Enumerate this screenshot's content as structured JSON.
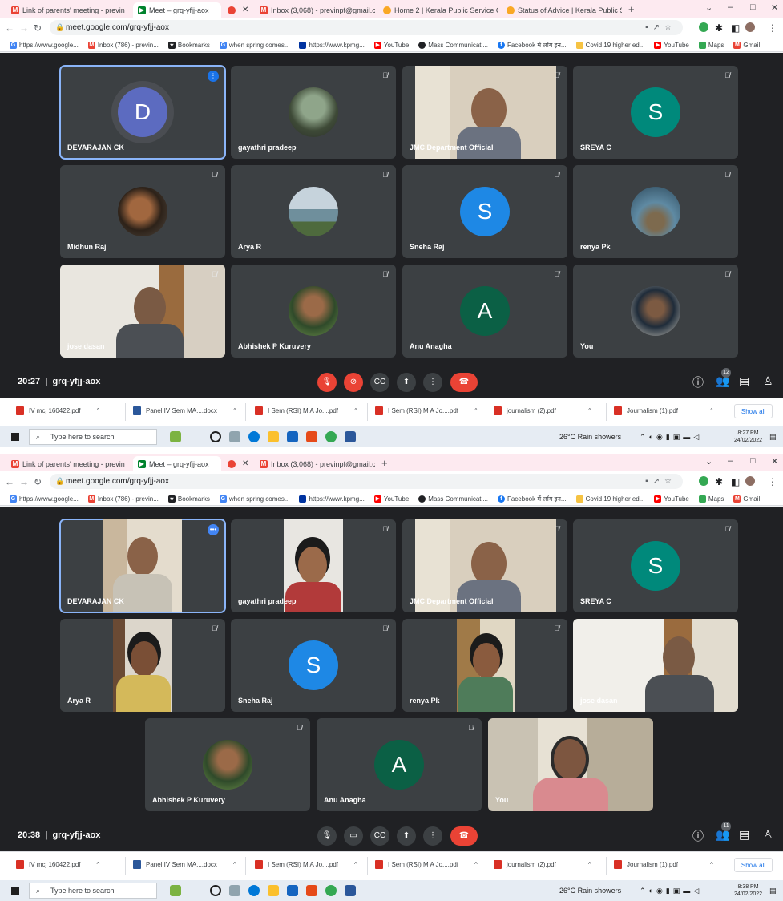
{
  "screenshots": [
    {
      "tabs": [
        {
          "title": "Link of parents' meeting - previn",
          "icon": "gmail-icon"
        },
        {
          "title": "Meet – grq-yfjj-aox",
          "icon": "meet-icon"
        },
        {
          "title": "",
          "icon": "record-icon"
        },
        {
          "title": "Inbox (3,068) - previnpf@gmail.c",
          "icon": "gmail-icon"
        },
        {
          "title": "Home 2 | Kerala Public Service C",
          "icon": "psc-icon"
        },
        {
          "title": "Status of Advice | Kerala Public S",
          "icon": "psc-icon"
        }
      ],
      "url": "meet.google.com/grq-yfjj-aox",
      "bookmarks": [
        "https://www.google...",
        "Inbox (786) - previn...",
        "Bookmarks",
        "when spring comes...",
        "https://www.kpmg...",
        "YouTube",
        "Mass Communicati...",
        "Facebook में लॉग इन...",
        "Covid 19 higher ed...",
        "YouTube",
        "Maps",
        "Gmail"
      ],
      "participants": [
        {
          "name": "DEVARAJAN CK",
          "kind": "avatar",
          "letter": "D",
          "color": "#5c6bc0",
          "speaking": true
        },
        {
          "name": "gayathri pradeep",
          "kind": "photo",
          "muted": true
        },
        {
          "name": "JMC Department Official",
          "kind": "video",
          "muted": true
        },
        {
          "name": "SREYA C",
          "kind": "avatar",
          "letter": "S",
          "color": "#00897b",
          "muted": true
        },
        {
          "name": "Midhun Raj",
          "kind": "photo",
          "muted": true
        },
        {
          "name": "Arya R",
          "kind": "photo",
          "muted": true
        },
        {
          "name": "Sneha Raj",
          "kind": "avatar",
          "letter": "S",
          "color": "#1e88e5",
          "muted": true
        },
        {
          "name": "renya Pk",
          "kind": "photo",
          "muted": true
        },
        {
          "name": "jose dasan",
          "kind": "video",
          "muted": true
        },
        {
          "name": "Abhishek P Kuruvery",
          "kind": "photo",
          "muted": true
        },
        {
          "name": "Anu Anagha",
          "kind": "avatar",
          "letter": "A",
          "color": "#0b6045",
          "muted": true
        },
        {
          "name": "You",
          "kind": "photo",
          "muted": true
        }
      ],
      "meeting_time": "20:27",
      "meeting_code": "grq-yfjj-aox",
      "participant_count": "12",
      "downloads": [
        "IV mcj 160422.pdf",
        "Panel IV Sem MA....docx",
        "I Sem (RSI) M A Jo....pdf",
        "I Sem (RSI) M A Jo....pdf",
        "journalism (2).pdf",
        "Journalism (1).pdf"
      ],
      "show_all": "Show all",
      "search_placeholder": "Type here to search",
      "weather": "26°C  Rain showers",
      "clock_time": "8:27 PM",
      "clock_date": "24/02/2022"
    },
    {
      "tabs": [
        {
          "title": "Link of parents' meeting - previn",
          "icon": "gmail-icon"
        },
        {
          "title": "Meet – grq-yfjj-aox",
          "icon": "meet-icon"
        },
        {
          "title": "",
          "icon": "record-icon"
        },
        {
          "title": "Inbox (3,068) - previnpf@gmail.c",
          "icon": "gmail-icon"
        }
      ],
      "url": "meet.google.com/grq-yfjj-aox",
      "bookmarks": [
        "https://www.google...",
        "Inbox (786) - previn...",
        "Bookmarks",
        "when spring comes...",
        "https://www.kpmg...",
        "YouTube",
        "Mass Communicati...",
        "Facebook में लॉग इन...",
        "Covid 19 higher ed...",
        "YouTube",
        "Maps",
        "Gmail"
      ],
      "participants": [
        {
          "name": "DEVARAJAN CK",
          "kind": "video",
          "speaking": true
        },
        {
          "name": "gayathri pradeep",
          "kind": "video",
          "muted": true
        },
        {
          "name": "JMC Department Official",
          "kind": "video",
          "muted": true
        },
        {
          "name": "SREYA C",
          "kind": "avatar",
          "letter": "S",
          "color": "#00897b",
          "muted": true
        },
        {
          "name": "Arya R",
          "kind": "video",
          "muted": true
        },
        {
          "name": "Sneha Raj",
          "kind": "avatar",
          "letter": "S",
          "color": "#1e88e5",
          "muted": true
        },
        {
          "name": "renya Pk",
          "kind": "video",
          "muted": true
        },
        {
          "name": "jose dasan",
          "kind": "video",
          "muted": false
        },
        {
          "name": "Abhishek P Kuruvery",
          "kind": "photo",
          "muted": true
        },
        {
          "name": "Anu Anagha",
          "kind": "avatar",
          "letter": "A",
          "color": "#0b6045",
          "muted": true
        },
        {
          "name": "You",
          "kind": "video",
          "muted": false
        }
      ],
      "meeting_time": "20:38",
      "meeting_code": "grq-yfjj-aox",
      "participant_count": "11",
      "downloads": [
        "IV mcj 160422.pdf",
        "Panel IV Sem MA....docx",
        "I Sem (RSI) M A Jo....pdf",
        "I Sem (RSI) M A Jo....pdf",
        "journalism (2).pdf",
        "Journalism (1).pdf"
      ],
      "show_all": "Show all",
      "search_placeholder": "Type here to search",
      "weather": "26°C  Rain showers",
      "clock_time": "8:38 PM",
      "clock_date": "24/02/2022"
    }
  ]
}
